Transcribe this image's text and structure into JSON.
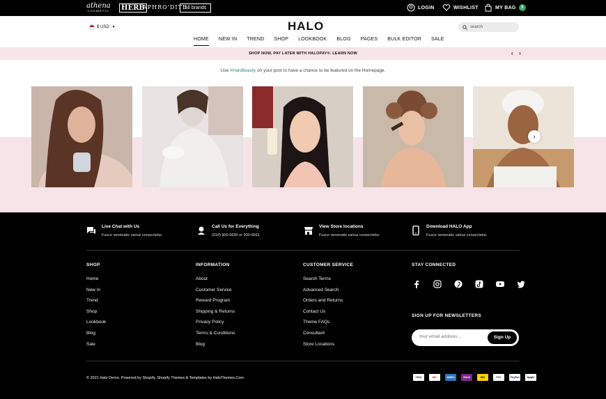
{
  "topbar": {
    "brands": {
      "athena": "athena",
      "athena_sub": "COSMETIC",
      "herb": "HERB",
      "aphrodite": "APHRO'DITE",
      "all": "All brands"
    },
    "login": "LOGIN",
    "wishlist": "WISHLIST",
    "bag": "MY BAG",
    "bag_count": "3"
  },
  "header": {
    "currency": "$ USD",
    "logo": "HALO",
    "search_placeholder": "search",
    "nav": [
      "HOME",
      "NEW IN",
      "TREND",
      "SHOP",
      "LOOKBOOK",
      "BLOG",
      "PAGES",
      "BULK EDITOR",
      "SALE"
    ]
  },
  "promo": {
    "text": "SHOP NOW, PAY LATER WITH HALOPAY®. LEARN NOW",
    "prev": "‹",
    "next": "›"
  },
  "instagram": {
    "prefix": "Use ",
    "hashtag": "#HaloBeauty",
    "suffix": " on your post to have a chance to be featured on the Homepage.",
    "next": "›"
  },
  "features": [
    {
      "title": "Live Chat with Us",
      "sub": "Fusce venenatis varius consectetur."
    },
    {
      "title": "Call Us for Everything",
      "sub": "(018) 900-6690 or 900-6691"
    },
    {
      "title": "View Store locations",
      "sub": "Fusce venenatis varius consectetur."
    },
    {
      "title": "Download HALO App",
      "sub": "Fusce venenatis varius consectetur."
    }
  ],
  "columns": {
    "shop": {
      "title": "SHOP",
      "items": [
        "Home",
        "New In",
        "Trend",
        "Shop",
        "Lookbook",
        "Blog",
        "Sale"
      ]
    },
    "information": {
      "title": "INFORMATION",
      "items": [
        "About",
        "Customer Service",
        "Reward Program",
        "Shipping & Returns",
        "Privacy Policy",
        "Terms & Conditions",
        "Blog"
      ]
    },
    "customer": {
      "title": "CUSTOMER SERVICE",
      "items": [
        "Search Terms",
        "Advanced Search",
        "Orders and Returns",
        "Contact Us",
        "Theme FAQs",
        "Consultant",
        "Store Locations"
      ]
    }
  },
  "social": {
    "title": "STAY CONNECTED",
    "icons": [
      "facebook-icon",
      "instagram-icon",
      "pinterest-icon",
      "tiktok-icon",
      "youtube-icon",
      "twitter-icon"
    ]
  },
  "newsletter": {
    "title": "SIGN UP FOR NEWSLETTERS",
    "placeholder": "Your email address...",
    "button": "Sign Up"
  },
  "copyright": "© 2021 Halo Demo. Powered by Shopify. Shopify Themes & Templates by HaloThemes.Com.",
  "payments": [
    "VISA",
    "MC",
    "AMEX",
    "Skrill",
    "WU",
    "PAY",
    "PayPal",
    "Apple Pay"
  ],
  "colors": {
    "accent": "#2a8a7c",
    "promo_bg": "#f6e4e9",
    "bag_badge": "#3aa35c"
  }
}
